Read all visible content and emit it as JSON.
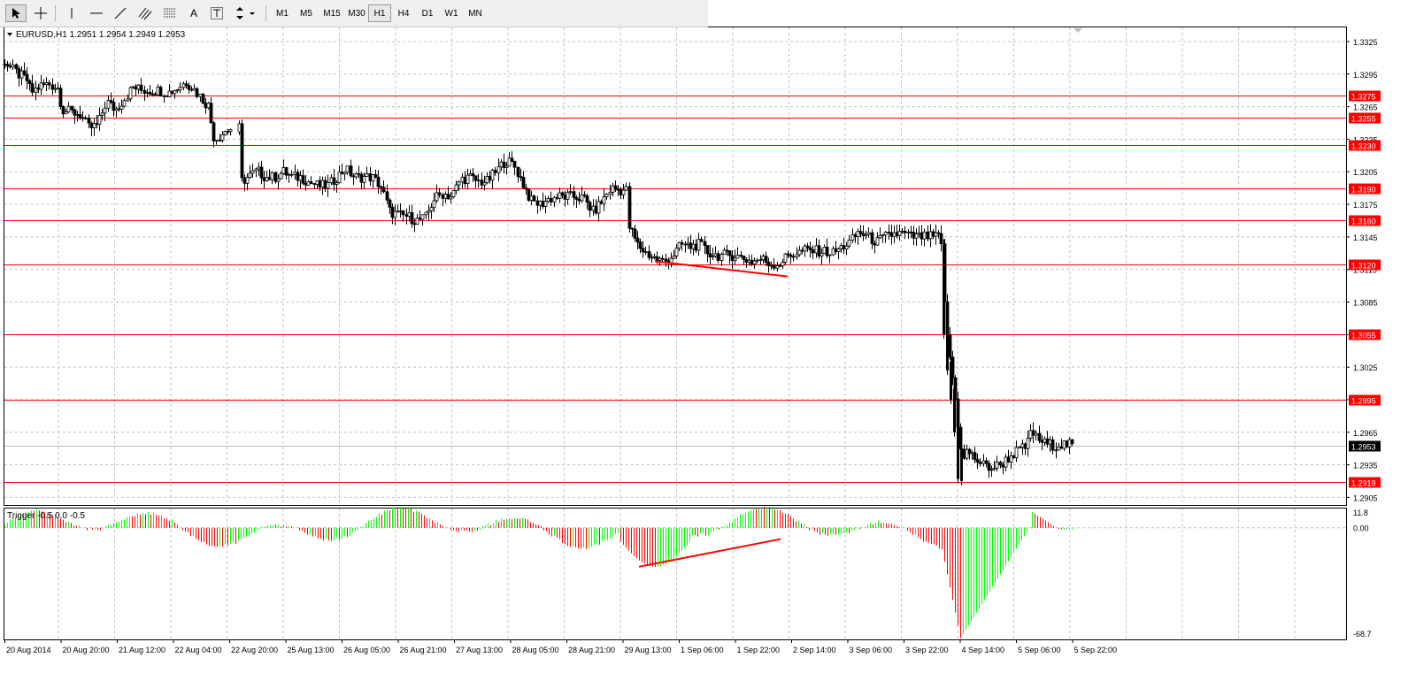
{
  "toolbar": {
    "tools": [
      {
        "name": "cursor-icon"
      },
      {
        "name": "crosshair-icon"
      },
      {
        "name": "vertical-line-icon"
      },
      {
        "name": "horizontal-line-icon"
      },
      {
        "name": "trendline-icon"
      },
      {
        "name": "equidistant-channel-icon"
      },
      {
        "name": "fibonacci-icon"
      },
      {
        "name": "text-label",
        "label": "A"
      },
      {
        "name": "text-box-icon"
      },
      {
        "name": "arrows-icon"
      }
    ],
    "timeframes": [
      "M1",
      "M5",
      "M15",
      "M30",
      "H1",
      "H4",
      "D1",
      "W1",
      "MN"
    ],
    "active_timeframe": "H1"
  },
  "main_panel": {
    "header": "EURUSD,H1  1.2951 1.2954 1.2949 1.2953"
  },
  "indicator_panel": {
    "header": "Trigger -0.5 0.0 -0.5"
  },
  "colors": {
    "up_candle": "#ffffff",
    "down_candle": "#000000",
    "level_line": "#ff0000",
    "hist_up": "#00ff00",
    "hist_down": "#ff0000",
    "grid": "#c0c0c0",
    "current_price_bg": "#000000"
  },
  "chart_data": [
    {
      "type": "candlestick",
      "symbol": "EURUSD",
      "timeframe": "H1",
      "ylim": [
        1.2898,
        1.3338
      ],
      "y_ticks": [
        "1.3325",
        "1.3295",
        "1.3265",
        "1.3235",
        "1.3205",
        "1.3175",
        "1.3145",
        "1.3115",
        "1.3085",
        "1.3055",
        "1.3025",
        "1.2995",
        "1.2965",
        "1.2935",
        "1.2905"
      ],
      "x_labels": [
        "20 Aug 2014",
        "20 Aug 20:00",
        "21 Aug 12:00",
        "22 Aug 04:00",
        "22 Aug 20:00",
        "25 Aug 13:00",
        "26 Aug 05:00",
        "26 Aug 21:00",
        "27 Aug 13:00",
        "28 Aug 05:00",
        "28 Aug 21:00",
        "29 Aug 13:00",
        "1 Sep 06:00",
        "1 Sep 22:00",
        "2 Sep 14:00",
        "3 Sep 06:00",
        "3 Sep 22:00",
        "4 Sep 14:00",
        "5 Sep 06:00",
        "5 Sep 22:00"
      ],
      "price_path": [
        [
          0,
          1.3313
        ],
        [
          10,
          1.3302
        ],
        [
          20,
          1.3295
        ],
        [
          30,
          1.329
        ],
        [
          35,
          1.3278
        ],
        [
          45,
          1.3284
        ],
        [
          55,
          1.3286
        ],
        [
          65,
          1.3282
        ],
        [
          70,
          1.3262
        ],
        [
          80,
          1.326
        ],
        [
          90,
          1.3258
        ],
        [
          100,
          1.3245
        ],
        [
          110,
          1.3248
        ],
        [
          120,
          1.327
        ],
        [
          130,
          1.3262
        ],
        [
          140,
          1.3272
        ],
        [
          150,
          1.3283
        ],
        [
          160,
          1.328
        ],
        [
          170,
          1.328
        ],
        [
          180,
          1.328
        ],
        [
          190,
          1.3278
        ],
        [
          200,
          1.3282
        ],
        [
          210,
          1.3288
        ],
        [
          220,
          1.328
        ],
        [
          230,
          1.327
        ],
        [
          236,
          1.3265
        ],
        [
          240,
          1.3238
        ],
        [
          245,
          1.3236
        ],
        [
          250,
          1.324
        ],
        [
          255,
          1.3243
        ],
        [
          262,
          1.3245
        ],
        [
          270,
          1.3195
        ],
        [
          280,
          1.32
        ],
        [
          290,
          1.3206
        ],
        [
          300,
          1.32
        ],
        [
          310,
          1.32
        ],
        [
          320,
          1.3205
        ],
        [
          330,
          1.32
        ],
        [
          340,
          1.32
        ],
        [
          350,
          1.3195
        ],
        [
          360,
          1.3192
        ],
        [
          370,
          1.3192
        ],
        [
          380,
          1.32
        ],
        [
          390,
          1.3208
        ],
        [
          400,
          1.32
        ],
        [
          410,
          1.32
        ],
        [
          420,
          1.32
        ],
        [
          430,
          1.3192
        ],
        [
          440,
          1.3168
        ],
        [
          450,
          1.3165
        ],
        [
          460,
          1.3164
        ],
        [
          470,
          1.316
        ],
        [
          480,
          1.3162
        ],
        [
          490,
          1.318
        ],
        [
          500,
          1.3185
        ],
        [
          510,
          1.3182
        ],
        [
          520,
          1.3198
        ],
        [
          530,
          1.32
        ],
        [
          540,
          1.3196
        ],
        [
          550,
          1.3196
        ],
        [
          560,
          1.3205
        ],
        [
          570,
          1.3215
        ],
        [
          580,
          1.3212
        ],
        [
          590,
          1.3195
        ],
        [
          600,
          1.3178
        ],
        [
          610,
          1.3175
        ],
        [
          620,
          1.318
        ],
        [
          630,
          1.3182
        ],
        [
          640,
          1.3182
        ],
        [
          650,
          1.3182
        ],
        [
          660,
          1.318
        ],
        [
          670,
          1.3168
        ],
        [
          680,
          1.3178
        ],
        [
          690,
          1.319
        ],
        [
          700,
          1.3188
        ],
        [
          710,
          1.3155
        ],
        [
          720,
          1.3138
        ],
        [
          730,
          1.313
        ],
        [
          740,
          1.3125
        ],
        [
          750,
          1.3122
        ],
        [
          760,
          1.3128
        ],
        [
          770,
          1.3138
        ],
        [
          780,
          1.3136
        ],
        [
          790,
          1.3138
        ],
        [
          800,
          1.313
        ],
        [
          810,
          1.3128
        ],
        [
          820,
          1.3128
        ],
        [
          830,
          1.3128
        ],
        [
          840,
          1.3125
        ],
        [
          850,
          1.3122
        ],
        [
          860,
          1.3125
        ],
        [
          870,
          1.312
        ],
        [
          880,
          1.312
        ],
        [
          890,
          1.3128
        ],
        [
          900,
          1.313
        ],
        [
          910,
          1.3133
        ],
        [
          920,
          1.3132
        ],
        [
          930,
          1.3132
        ],
        [
          940,
          1.313
        ],
        [
          950,
          1.3135
        ],
        [
          960,
          1.314
        ],
        [
          970,
          1.315
        ],
        [
          980,
          1.3145
        ],
        [
          990,
          1.314
        ],
        [
          1000,
          1.3145
        ],
        [
          1010,
          1.3148
        ],
        [
          1020,
          1.3148
        ],
        [
          1030,
          1.3145
        ],
        [
          1040,
          1.3145
        ],
        [
          1050,
          1.3145
        ],
        [
          1060,
          1.3145
        ],
        [
          1064,
          1.3135
        ],
        [
          1068,
          1.306
        ],
        [
          1072,
          1.304
        ],
        [
          1076,
          1.3015
        ],
        [
          1080,
          1.299
        ],
        [
          1084,
          1.296
        ],
        [
          1088,
          1.2938
        ],
        [
          1092,
          1.2948
        ],
        [
          1100,
          1.2942
        ],
        [
          1110,
          1.2935
        ],
        [
          1120,
          1.2932
        ],
        [
          1130,
          1.2935
        ],
        [
          1140,
          1.2942
        ],
        [
          1150,
          1.2948
        ],
        [
          1160,
          1.2952
        ],
        [
          1165,
          1.2968
        ],
        [
          1170,
          1.296
        ],
        [
          1180,
          1.2955
        ],
        [
          1190,
          1.2953
        ],
        [
          1200,
          1.2954
        ],
        [
          1212,
          1.2953
        ]
      ],
      "horizontal_levels": [
        "1.3275",
        "1.3255",
        "1.3230",
        "1.3190",
        "1.3160",
        "1.3120",
        "1.3055",
        "1.2995",
        "1.2919"
      ],
      "current_price": "1.2953",
      "trendline": {
        "from": [
          740,
          1.31225
        ],
        "to": [
          890,
          1.31085
        ]
      }
    },
    {
      "type": "histogram",
      "name": "Trigger",
      "ylim": [
        -68.7,
        11.8
      ],
      "y_ticks": [
        "11.8",
        "0.00",
        "-68.7"
      ],
      "trendline": {
        "from": [
          722,
          -24
        ],
        "to": [
          882,
          -7
        ]
      }
    }
  ]
}
